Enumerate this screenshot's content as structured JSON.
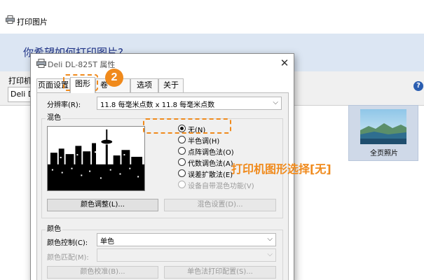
{
  "background_window": {
    "title": "打印图片",
    "question": "你希望如何打印图片?",
    "printer_label": "打印机",
    "printer_value": "Deli D",
    "help_glyph": "?",
    "thumbnail_label": "全页照片"
  },
  "dialog": {
    "title": "Deli DL-825T 属性",
    "close_glyph": "✕",
    "tabs": [
      {
        "label": "页面设置",
        "active": false
      },
      {
        "label": "图形",
        "active": true
      },
      {
        "label": "卷",
        "active": false
      },
      {
        "label": "选项",
        "active": false
      },
      {
        "label": "关于",
        "active": false
      }
    ],
    "resolution": {
      "label": "分辨率(R):",
      "value": "11.8 每毫米点数 x 11.8 每毫米点数"
    },
    "dithering": {
      "group_title": "混色",
      "options": [
        {
          "label": "无(N)",
          "checked": true,
          "enabled": true
        },
        {
          "label": "半色调(H)",
          "checked": false,
          "enabled": true
        },
        {
          "label": "点阵调色法(O)",
          "checked": false,
          "enabled": true
        },
        {
          "label": "代数调色法(A)",
          "checked": false,
          "enabled": true
        },
        {
          "label": "误差扩散法(E)",
          "checked": false,
          "enabled": true
        },
        {
          "label": "设备自带混色功能(V)",
          "checked": false,
          "enabled": false
        }
      ],
      "color_adjust_button": "颜色调整(L)...",
      "dither_settings_button": "混色设置(D)..."
    },
    "color": {
      "group_title": "颜色",
      "control_label": "颜色控制(C):",
      "control_value": "单色",
      "matching_label": "颜色匹配(M):",
      "matching_value": "",
      "calibrate_button": "颜色校准(B)...",
      "mono_config_button": "单色法打印配置(S)..."
    }
  },
  "annotations": {
    "step_number": "2",
    "callout_text": "打印机图形选择[无]",
    "accent_color": "#f08a1c"
  },
  "icons": [
    "printer-icon",
    "close-icon",
    "chevron-down-icon",
    "help-icon",
    "landscape-thumbnail"
  ]
}
